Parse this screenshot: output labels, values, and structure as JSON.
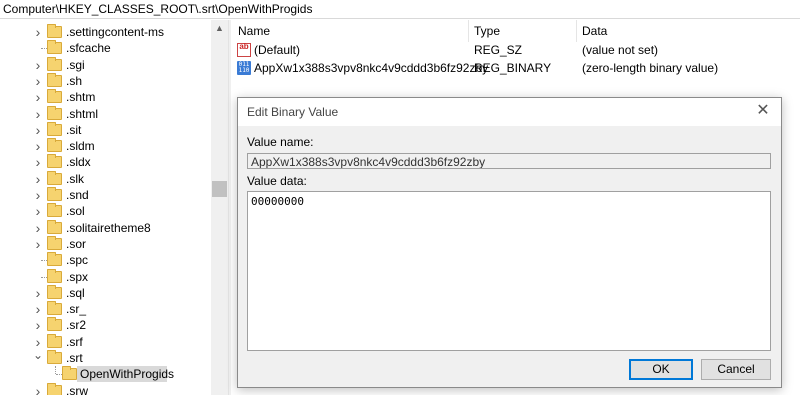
{
  "address": "Computer\\HKEY_CLASSES_ROOT\\.srt\\OpenWithProgids",
  "tree": {
    "items": [
      {
        "label": ".settingcontent-ms",
        "expander": "collapsed"
      },
      {
        "label": ".sfcache",
        "expander": "none"
      },
      {
        "label": ".sgi",
        "expander": "collapsed"
      },
      {
        "label": ".sh",
        "expander": "collapsed"
      },
      {
        "label": ".shtm",
        "expander": "collapsed"
      },
      {
        "label": ".shtml",
        "expander": "collapsed"
      },
      {
        "label": ".sit",
        "expander": "collapsed"
      },
      {
        "label": ".sldm",
        "expander": "collapsed"
      },
      {
        "label": ".sldx",
        "expander": "collapsed"
      },
      {
        "label": ".slk",
        "expander": "collapsed"
      },
      {
        "label": ".snd",
        "expander": "collapsed"
      },
      {
        "label": ".sol",
        "expander": "collapsed"
      },
      {
        "label": ".solitairetheme8",
        "expander": "collapsed"
      },
      {
        "label": ".sor",
        "expander": "collapsed"
      },
      {
        "label": ".spc",
        "expander": "none"
      },
      {
        "label": ".spx",
        "expander": "none"
      },
      {
        "label": ".sql",
        "expander": "collapsed"
      },
      {
        "label": ".sr_",
        "expander": "collapsed"
      },
      {
        "label": ".sr2",
        "expander": "collapsed"
      },
      {
        "label": ".srf",
        "expander": "collapsed"
      },
      {
        "label": ".srt",
        "expander": "expanded"
      },
      {
        "label": "OpenWithProgids",
        "expander": "child-selected"
      },
      {
        "label": ".srw",
        "expander": "collapsed"
      }
    ]
  },
  "list": {
    "columns": [
      "Name",
      "Type",
      "Data"
    ],
    "rows": [
      {
        "name": "(Default)",
        "type": "REG_SZ",
        "data": "(value not set)",
        "icon": "string-value-icon"
      },
      {
        "name": "AppXw1x388s3vpv8nkc4v9cddd3b6fz92zby",
        "type": "REG_BINARY",
        "data": "(zero-length binary value)",
        "icon": "binary-value-icon"
      }
    ]
  },
  "dialog": {
    "title": "Edit Binary Value",
    "value_name_label": "Value name:",
    "value_name": "AppXw1x388s3vpv8nkc4v9cddd3b6fz92zby",
    "value_data_label": "Value data:",
    "value_data": "00000000",
    "ok_label": "OK",
    "cancel_label": "Cancel",
    "accent": "#0078d7"
  }
}
